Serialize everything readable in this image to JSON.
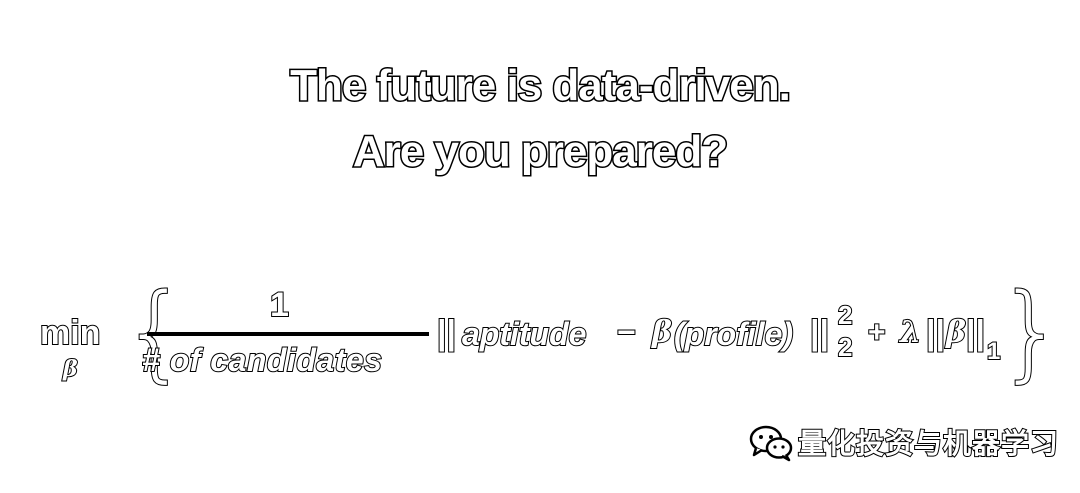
{
  "headline": {
    "line1": "The future is data-driven.",
    "line2": "Are you prepared?"
  },
  "formula": {
    "min": "min",
    "min_subscript": "β",
    "brace_left": "{",
    "brace_right": "}",
    "numerator": "1",
    "denominator": "# of  candidates",
    "norm_open": "||",
    "aptitude": "aptitude",
    "minus": "−",
    "beta": "β",
    "profile": "(profile)",
    "norm_close": "||",
    "superscript": "2",
    "subscript": "2",
    "plus": "+",
    "lambda": "λ",
    "norm1_open": "||",
    "beta_reg": "β",
    "norm1_close": "||",
    "norm1_subscript": "1"
  },
  "watermark": {
    "icon": "wechat-icon",
    "text": "量化投资与机器学习"
  }
}
